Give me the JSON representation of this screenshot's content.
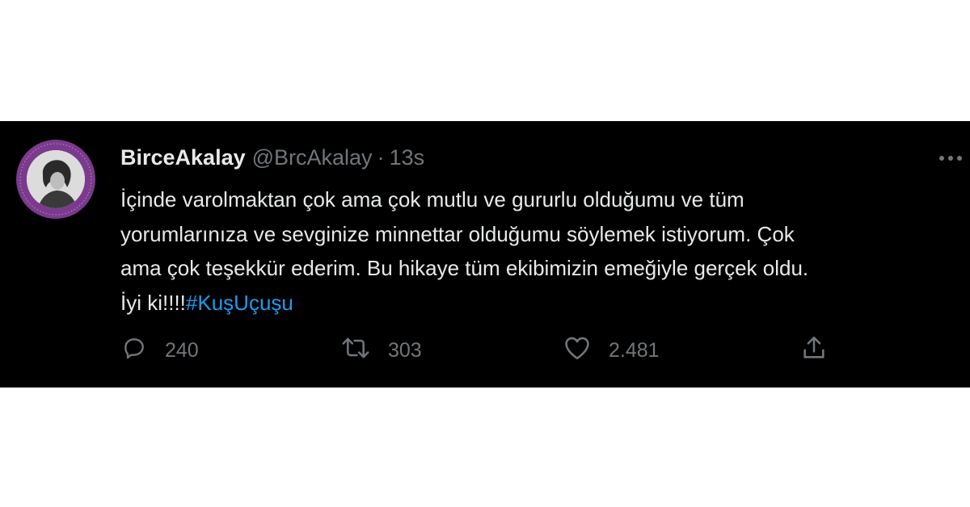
{
  "tweet": {
    "display_name": "BirceAkalay",
    "handle": "@BrcAkalay",
    "separator": "·",
    "timestamp": "13s",
    "text_lines": [
      "İçinde varolmaktan çok ama çok mutlu ve gururlu olduğumu ve tüm",
      "yorumlarınıza ve sevginize minnettar olduğumu söylemek istiyorum. Çok",
      "ama çok teşekkür ederim. Bu hikaye tüm ekibimizin emeğiyle gerçek oldu.",
      "İyi ki!!!!"
    ],
    "hashtag": "#KuşUçuşu",
    "more_icon": "more-horizontal-icon",
    "avatar_color": "#7b3a8e",
    "link_color": "#1d9bf0",
    "background_color": "#000000"
  },
  "actions": {
    "reply": {
      "icon": "reply-icon",
      "count": "240"
    },
    "retweet": {
      "icon": "retweet-icon",
      "count": "303"
    },
    "like": {
      "icon": "heart-icon",
      "count": "2.481"
    },
    "share": {
      "icon": "share-icon"
    }
  }
}
